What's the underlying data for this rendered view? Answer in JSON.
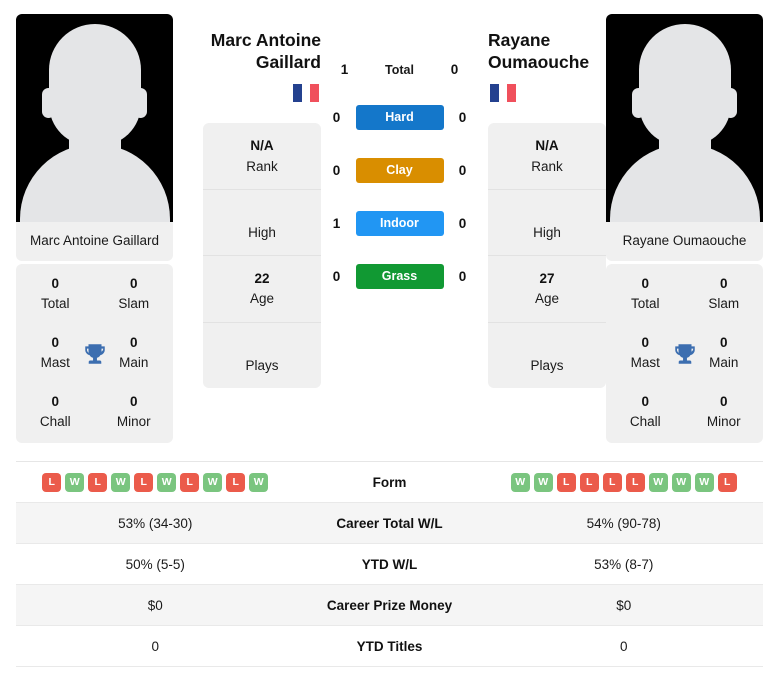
{
  "players": {
    "left": {
      "name_line1": "Marc Antoine",
      "name_line2": "Gaillard",
      "full_name": "Marc Antoine Gaillard",
      "country_icon": "flag-france-icon",
      "titles": [
        {
          "value": "0",
          "label": "Total"
        },
        {
          "value": "0",
          "label": "Slam"
        },
        {
          "value": "0",
          "label": "Mast"
        },
        {
          "value": "0",
          "label": "Main"
        },
        {
          "value": "0",
          "label": "Chall"
        },
        {
          "value": "0",
          "label": "Minor"
        }
      ],
      "info": [
        {
          "value": "N/A",
          "label": "Rank"
        },
        {
          "value": "",
          "label": "High"
        },
        {
          "value": "22",
          "label": "Age"
        },
        {
          "value": "",
          "label": "Plays"
        }
      ],
      "form": [
        "L",
        "W",
        "L",
        "W",
        "L",
        "W",
        "L",
        "W",
        "L",
        "W"
      ],
      "career_total_wl": "53% (34-30)",
      "ytd_wl": "50% (5-5)",
      "career_prize_money": "$0",
      "ytd_titles": "0"
    },
    "right": {
      "name_line1": "Rayane",
      "name_line2": "Oumaouche",
      "full_name": "Rayane Oumaouche",
      "country_icon": "flag-france-icon",
      "titles": [
        {
          "value": "0",
          "label": "Total"
        },
        {
          "value": "0",
          "label": "Slam"
        },
        {
          "value": "0",
          "label": "Mast"
        },
        {
          "value": "0",
          "label": "Main"
        },
        {
          "value": "0",
          "label": "Chall"
        },
        {
          "value": "0",
          "label": "Minor"
        }
      ],
      "info": [
        {
          "value": "N/A",
          "label": "Rank"
        },
        {
          "value": "",
          "label": "High"
        },
        {
          "value": "27",
          "label": "Age"
        },
        {
          "value": "",
          "label": "Plays"
        }
      ],
      "form": [
        "W",
        "W",
        "L",
        "L",
        "L",
        "L",
        "W",
        "W",
        "W",
        "L"
      ],
      "career_total_wl": "54% (90-78)",
      "ytd_wl": "53% (8-7)",
      "career_prize_money": "$0",
      "ytd_titles": "0"
    }
  },
  "head_to_head": {
    "total": {
      "label": "Total",
      "left": "1",
      "right": "0"
    },
    "surfaces": [
      {
        "label": "Hard",
        "left": "0",
        "right": "0",
        "color": "#1477ca"
      },
      {
        "label": "Clay",
        "left": "0",
        "right": "0",
        "color": "#d98e00"
      },
      {
        "label": "Indoor",
        "left": "1",
        "right": "0",
        "color": "#2196f3"
      },
      {
        "label": "Grass",
        "left": "0",
        "right": "0",
        "color": "#119933"
      }
    ]
  },
  "comparison_rows": [
    {
      "label": "Form",
      "type": "form"
    },
    {
      "label": "Career Total W/L",
      "type": "text",
      "key": "career_total_wl"
    },
    {
      "label": "YTD W/L",
      "type": "text",
      "key": "ytd_wl"
    },
    {
      "label": "Career Prize Money",
      "type": "text",
      "key": "career_prize_money"
    },
    {
      "label": "YTD Titles",
      "type": "text",
      "key": "ytd_titles"
    }
  ],
  "theme": {
    "card_bg": "#f0f0f0",
    "row_alt_bg": "#f5f5f5",
    "win_color": "#7ac57f",
    "loss_color": "#eb5b4b",
    "trophy_color": "#3c6eb0"
  }
}
